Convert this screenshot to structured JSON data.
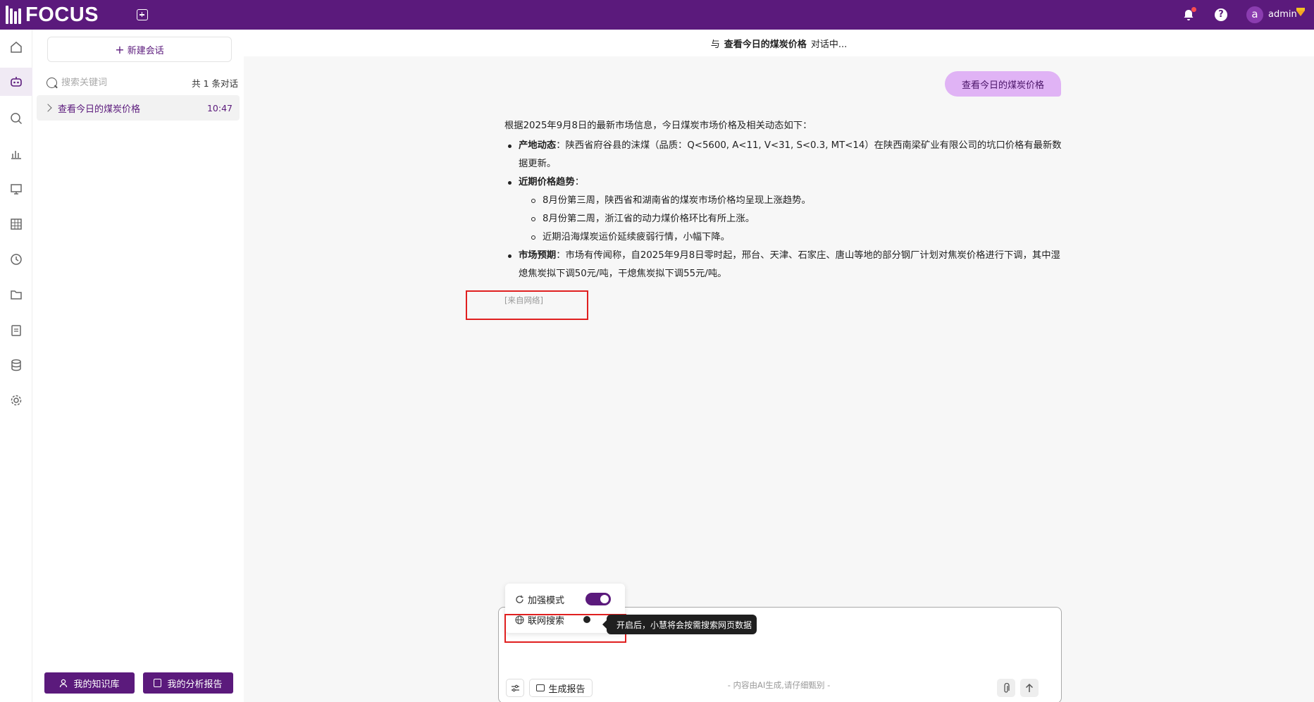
{
  "app": {
    "logo_text": "FOCUS"
  },
  "topbar": {
    "username": "admin",
    "avatar_letter": "a"
  },
  "sidebar": {
    "new_chat_label": "新建会话",
    "search_placeholder": "搜索关键词",
    "count_label": "共 1 条对话",
    "conversations": [
      {
        "title": "查看今日的煤炭价格",
        "time": "10:47"
      }
    ],
    "knowledge_base_label": "我的知识库",
    "analysis_report_label": "我的分析报告"
  },
  "main": {
    "header_prefix": "与",
    "header_title": "查看今日的煤炭价格",
    "header_suffix": "对话中...",
    "user_message": "查看今日的煤炭价格",
    "answer": {
      "intro": "根据2025年9月8日的最新市场信息，今日煤炭市场价格及相关动态如下：",
      "item1_title": "产地动态",
      "item1_text": "：陕西省府谷县的沫煤（品质：Q<5600, A<11, V<31, S<0.3, MT<14）在陕西南梁矿业有限公司的坑口价格有最新数据更新。",
      "item2_title": "近期价格趋势",
      "item2_colon": "：",
      "item2_sub": [
        "8月份第三周，陕西省和湖南省的煤炭市场价格均呈现上涨趋势。",
        "8月份第二周，浙江省的动力煤价格环比有所上涨。",
        "近期沿海煤炭运价延续疲弱行情，小幅下降。"
      ],
      "item3_title": "市场预期",
      "item3_text": "：市场有传闻称，自2025年9月8日零时起，邢台、天津、石家庄、唐山等地的部分钢厂计划对焦炭价格进行下调，其中湿熄焦炭拟下调50元/吨，干熄焦炭拟下调55元/吨。",
      "source": "[来自网络]"
    },
    "modes": {
      "enhanced_label": "加强模式",
      "enhanced_on": true,
      "web_search_label": "联网搜索",
      "web_search_on": false,
      "tooltip": "开启后，小慧将会按需搜索网页数据"
    },
    "input": {
      "generate_report_label": "生成报告"
    },
    "disclaimer": "- 内容由AI生成,请仔细甄别 -"
  },
  "colors": {
    "brand": "#5b1a7c",
    "user_bubble": "#e0b3f5",
    "highlight_box": "#e02020"
  }
}
